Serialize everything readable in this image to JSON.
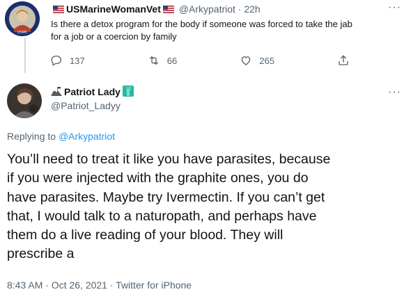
{
  "parent_tweet": {
    "display_name": "USMarineWomanVet",
    "handle": "@Arkypatriot",
    "time": "22h",
    "text_line1": "Is there a detox program for the body if someone was forced to take the jab",
    "text_line2": "for a job or a coercion by family",
    "replies": "137",
    "retweets": "66",
    "likes": "265"
  },
  "main_tweet": {
    "display_name": "Patriot Lady",
    "handle": "@Patriot_Ladyy",
    "replying_to_label": "Replying to",
    "replying_to_handle": "@Arkypatriot",
    "body_lines": [
      "You’ll need to treat it like you have parasites, because",
      "if you were injected with the graphite ones, you do",
      "have parasites. Maybe try Ivermectin. If you can’t get",
      "that, I would talk to a naturopath, and perhaps have",
      "them do a live reading of your blood. They will",
      "prescribe a"
    ],
    "timestamp": "8:43 AM · Oct 26, 2021 · Twitter for iPhone"
  },
  "icons": {
    "more": "more-icon",
    "reply": "reply-icon",
    "retweet": "retweet-icon",
    "like": "like-icon",
    "share": "share-icon",
    "flag": "us-flag-icon",
    "statue": "statue-of-liberty-icon"
  },
  "colors": {
    "link": "#1d9bf0",
    "muted": "#536471",
    "text": "#0f1419",
    "thread_line": "#cfd9de"
  }
}
